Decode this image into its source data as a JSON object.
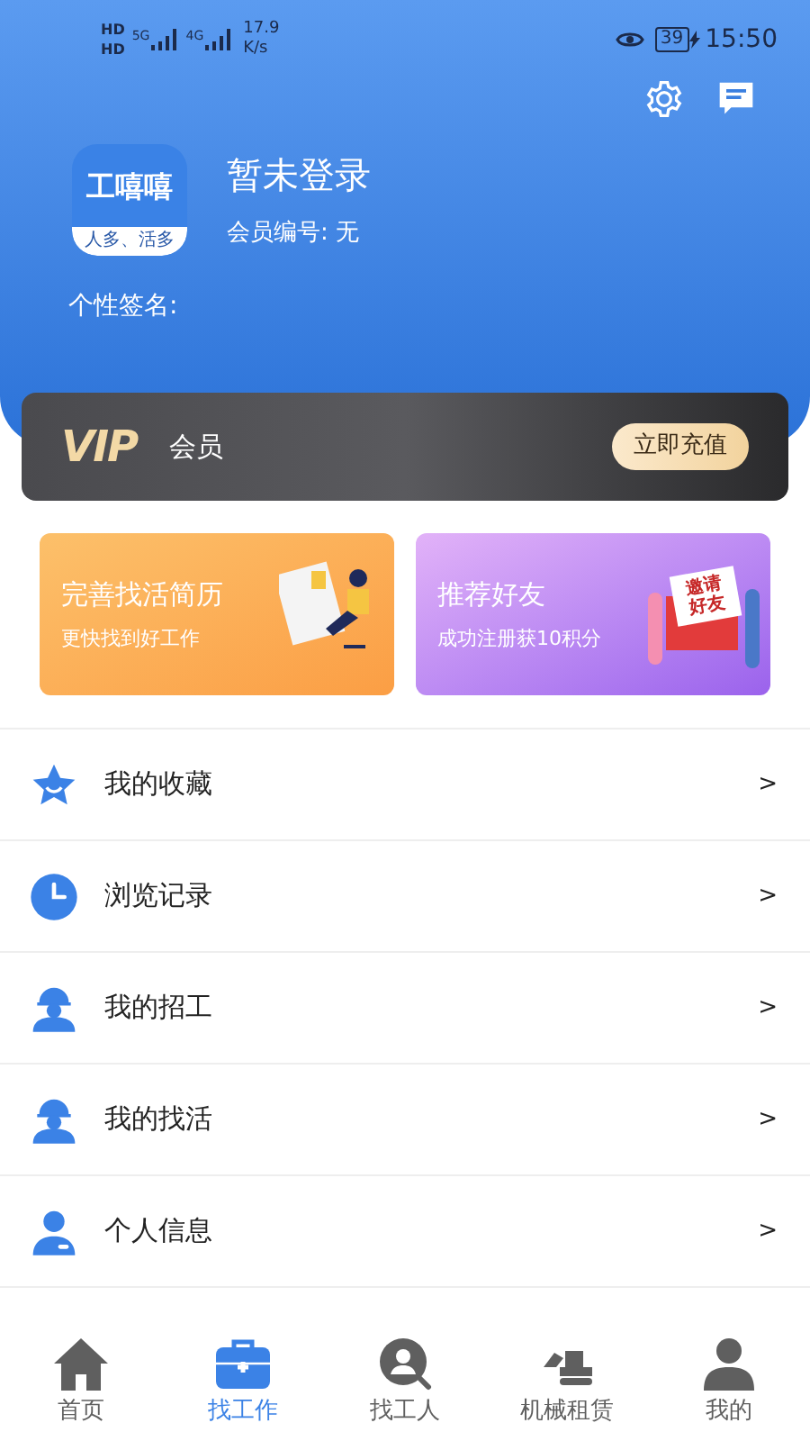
{
  "status_bar": {
    "sim_labels": [
      "HD",
      "HD"
    ],
    "networks": [
      "5G",
      "4G"
    ],
    "speed": "17.9",
    "speed_unit": "K/s",
    "battery": "39",
    "time": "15:50"
  },
  "profile": {
    "logo_title": "工嘻嘻",
    "logo_tagline": "人多、活多",
    "name": "暂未登录",
    "member_id": "会员编号: 无",
    "signature": "个性签名:"
  },
  "vip": {
    "logo": "VIP",
    "label": "会员",
    "button": "立即充值"
  },
  "promos": [
    {
      "kind": "resume",
      "title": "完善找活简历",
      "subtitle": "更快找到好工作"
    },
    {
      "kind": "invite",
      "title": "推荐好友",
      "subtitle": "成功注册获10积分",
      "art_text": "邀请好友"
    }
  ],
  "menu": [
    {
      "kind": "star",
      "label": "我的收藏",
      "arrow": ">"
    },
    {
      "kind": "clock",
      "label": "浏览记录",
      "arrow": ">"
    },
    {
      "kind": "worker",
      "label": "我的招工",
      "arrow": ">"
    },
    {
      "kind": "worker",
      "label": "我的找活",
      "arrow": ">"
    },
    {
      "kind": "person",
      "label": "个人信息",
      "arrow": ">"
    }
  ],
  "tabs": [
    {
      "kind": "home",
      "label": "首页",
      "selected": false
    },
    {
      "kind": "briefcase",
      "label": "找工作",
      "selected": true
    },
    {
      "kind": "search-person",
      "label": "找工人",
      "selected": false
    },
    {
      "kind": "excavator",
      "label": "机械租赁",
      "selected": false
    },
    {
      "kind": "user",
      "label": "我的",
      "selected": false
    }
  ]
}
